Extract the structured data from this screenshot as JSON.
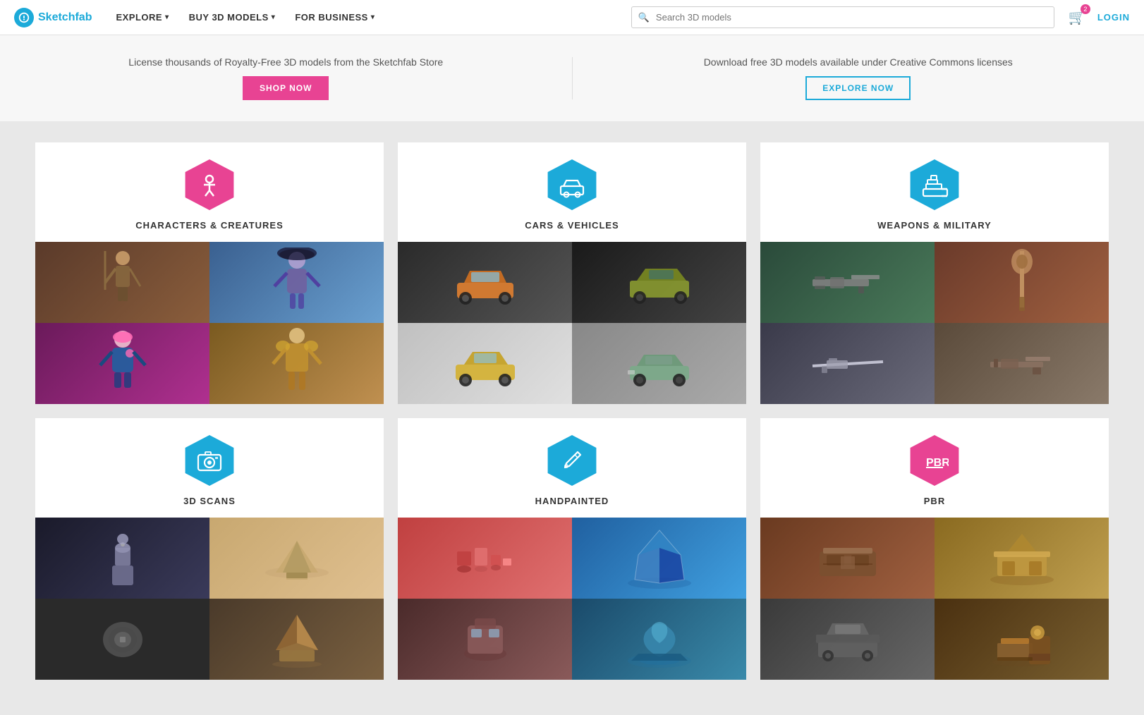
{
  "navbar": {
    "logo_text": "Sketchfab",
    "explore_label": "EXPLORE",
    "buy_label": "BUY 3D MODELS",
    "business_label": "FOR BUSINESS",
    "search_placeholder": "Search 3D models",
    "cart_count": "2",
    "login_label": "LOGIN"
  },
  "promo": {
    "left_text": "License thousands of Royalty-Free 3D models from the Sketchfab Store",
    "left_btn": "SHOP NOW",
    "right_text": "Download free 3D models available under Creative Commons licenses",
    "right_btn": "EXPLORE NOW"
  },
  "categories": [
    {
      "id": "characters",
      "title": "CHARACTERS & CREATURES",
      "icon_type": "character",
      "hex_color": "pink",
      "images": [
        "char1",
        "char2",
        "char3",
        "char4"
      ]
    },
    {
      "id": "cars",
      "title": "CARS & VEHICLES",
      "icon_type": "car",
      "hex_color": "blue",
      "images": [
        "car1",
        "car2",
        "car3",
        "car4"
      ]
    },
    {
      "id": "weapons",
      "title": "WEAPONS & MILITARY",
      "icon_type": "tank",
      "hex_color": "blue",
      "images": [
        "wpn1",
        "wpn2",
        "wpn3",
        "wpn4"
      ]
    },
    {
      "id": "scans",
      "title": "3D SCANS",
      "icon_type": "camera",
      "hex_color": "blue",
      "images": [
        "scan1",
        "scan2",
        "scan3",
        "scan4"
      ]
    },
    {
      "id": "handpainted",
      "title": "HANDPAINTED",
      "icon_type": "brush",
      "hex_color": "blue",
      "images": [
        "hand1",
        "hand2",
        "hand3",
        "hand4"
      ]
    },
    {
      "id": "pbr",
      "title": "PBR",
      "icon_type": "pbr",
      "hex_color": "pbr",
      "images": [
        "pbr1",
        "pbr2",
        "pbr3",
        "pbr4"
      ]
    }
  ]
}
